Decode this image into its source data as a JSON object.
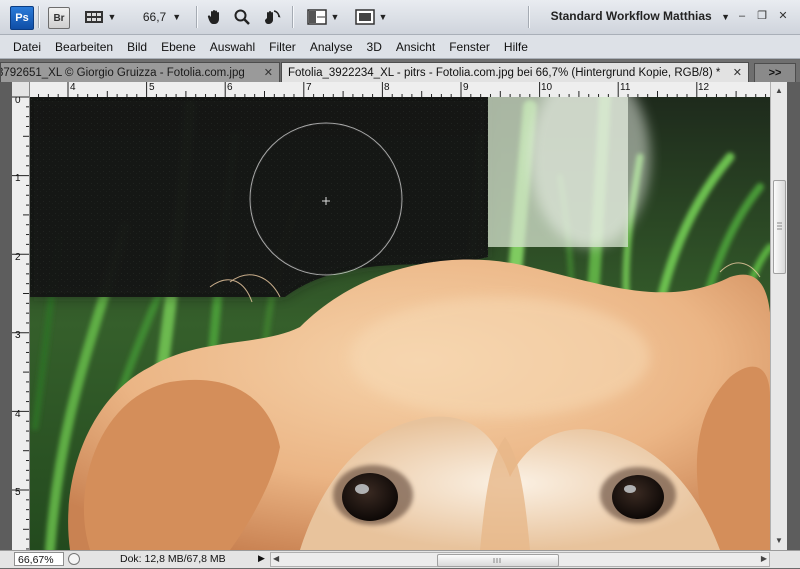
{
  "appbar": {
    "ps_label": "Ps",
    "br_label": "Br",
    "zoom_value": "66,7",
    "workspace_name": "Standard Workflow Matthias",
    "minimize": "–",
    "restore": "❐",
    "close": "✕"
  },
  "menu": [
    "Datei",
    "Bearbeiten",
    "Bild",
    "Ebene",
    "Auswahl",
    "Filter",
    "Analyse",
    "3D",
    "Ansicht",
    "Fenster",
    "Hilfe"
  ],
  "tabs": [
    {
      "label": "3792651_XL © Giorgio Gruizza - Fotolia.com.jpg",
      "active": false
    },
    {
      "label": "Fotolia_3922234_XL - pitrs - Fotolia.com.jpg bei 66,7% (Hintergrund Kopie, RGB/8) *",
      "active": true
    }
  ],
  "tab_overflow": ">>",
  "ruler_h": [
    "4",
    "5",
    "6",
    "7",
    "8",
    "9",
    "10",
    "11",
    "12"
  ],
  "ruler_v": [
    "0",
    "1",
    "2",
    "3",
    "4",
    "5"
  ],
  "status": {
    "zoom": "66,67%",
    "doc_info": "Dok: 12,8 MB/67,8 MB"
  },
  "colors": {
    "ui_bg": "#dde1e7",
    "canvas_dark": "#1a1d1a",
    "grass": "#4e9a3a",
    "fur": "#e8b07f"
  }
}
